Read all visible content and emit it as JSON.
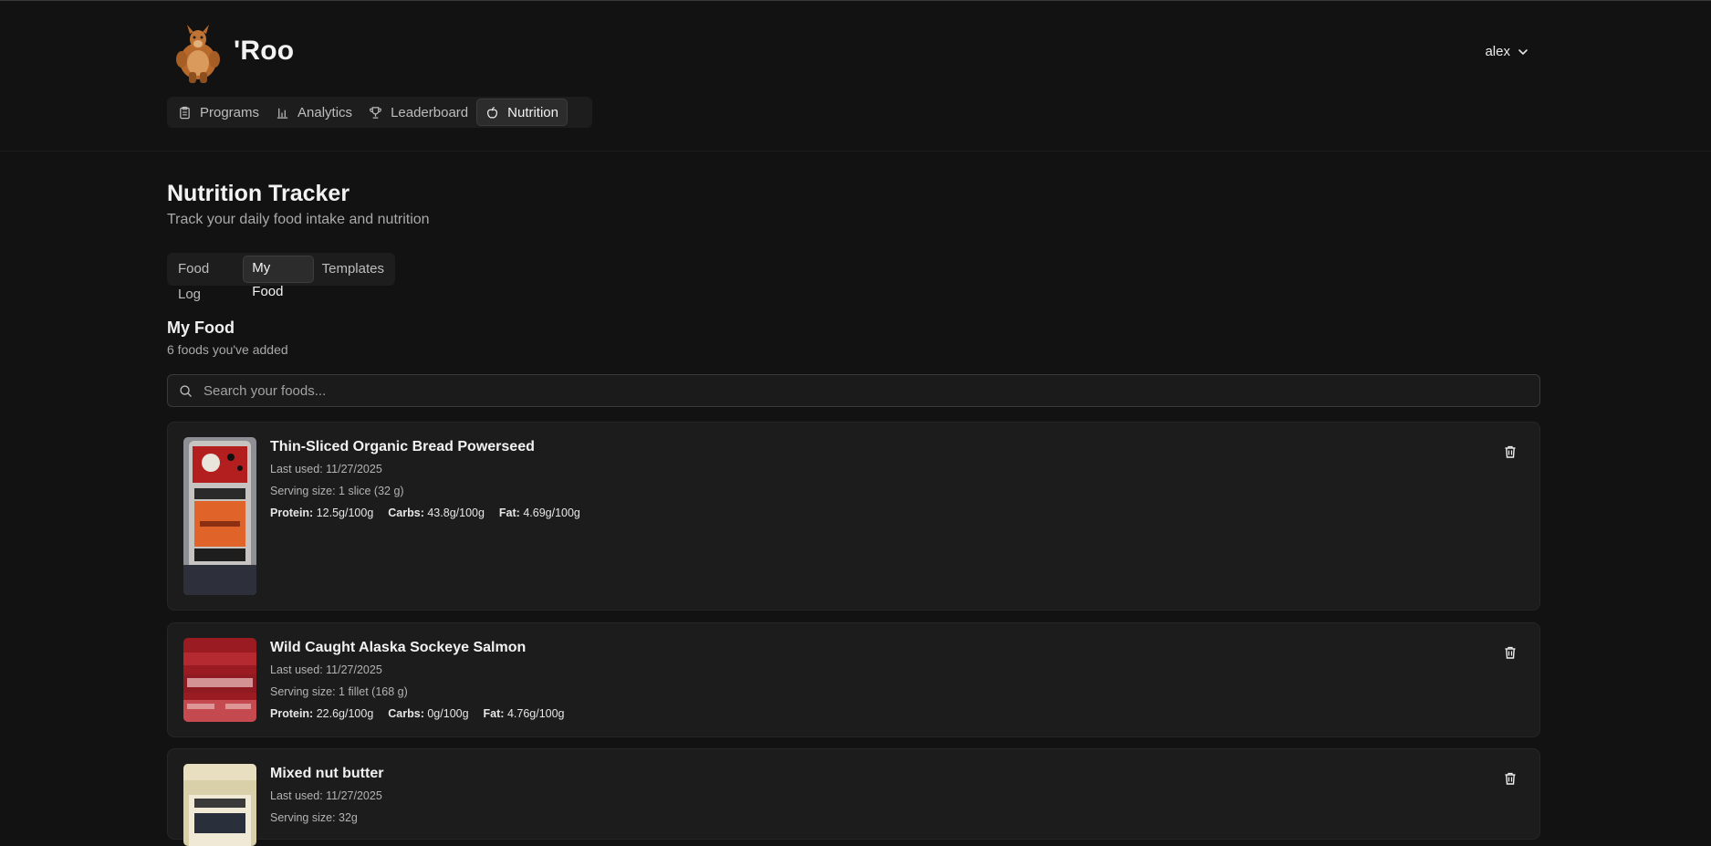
{
  "app": {
    "brand": "'Roo",
    "user": "alex"
  },
  "nav": {
    "items": [
      {
        "label": "Programs",
        "icon": "clipboard-icon"
      },
      {
        "label": "Analytics",
        "icon": "bar-chart-icon"
      },
      {
        "label": "Leaderboard",
        "icon": "trophy-icon"
      },
      {
        "label": "Nutrition",
        "icon": "apple-icon",
        "active": true
      }
    ]
  },
  "page": {
    "title": "Nutrition Tracker",
    "subtitle": "Track your daily food intake and nutrition"
  },
  "tabs": [
    {
      "label": "Food Log"
    },
    {
      "label": "My Food",
      "active": true
    },
    {
      "label": "Templates"
    }
  ],
  "section": {
    "title": "My Food",
    "subtitle": "6 foods you've added"
  },
  "search": {
    "placeholder": "Search your foods..."
  },
  "foods": [
    {
      "name": "Thin-Sliced Organic Bread Powerseed",
      "last_used": "Last used: 11/27/2025",
      "serving": "Serving size: 1 slice (32 g)",
      "protein_label": "Protein:",
      "protein": "12.5g/100g",
      "carbs_label": "Carbs:",
      "carbs": "43.8g/100g",
      "fat_label": "Fat:",
      "fat": "4.69g/100g"
    },
    {
      "name": "Wild Caught Alaska Sockeye Salmon",
      "last_used": "Last used: 11/27/2025",
      "serving": "Serving size: 1 fillet (168 g)",
      "protein_label": "Protein:",
      "protein": "22.6g/100g",
      "carbs_label": "Carbs:",
      "carbs": "0g/100g",
      "fat_label": "Fat:",
      "fat": "4.76g/100g"
    },
    {
      "name": "Mixed nut butter",
      "last_used": "Last used: 11/27/2025",
      "serving": "Serving size: 32g"
    }
  ],
  "colors": {
    "background": "#121212",
    "card": "#1c1c1c",
    "active_tab": "#2c2c2c",
    "text": "#e9e9e9",
    "muted": "#a9a9a9"
  }
}
